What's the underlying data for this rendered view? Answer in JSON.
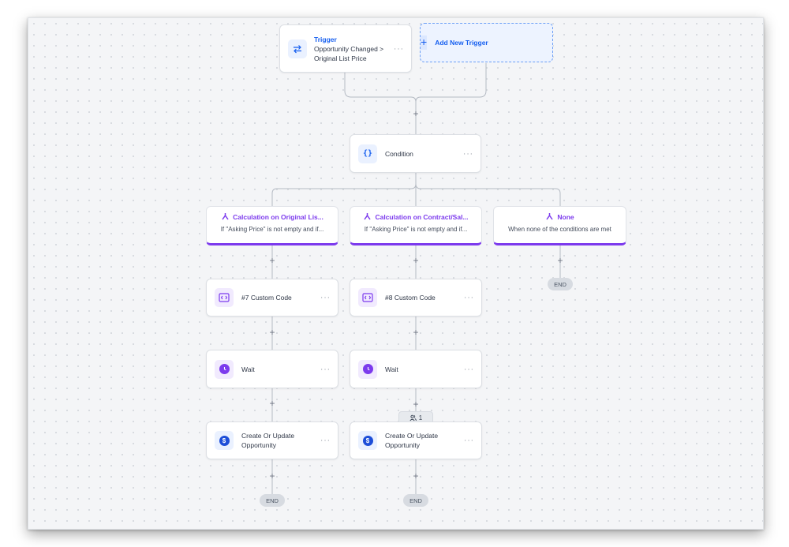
{
  "trigger": {
    "title": "Trigger",
    "subtitle_line1": "Opportunity Changed >",
    "subtitle_line2": "Original List Price",
    "menu": "···"
  },
  "add_trigger": {
    "label": "Add New Trigger",
    "plus": "+"
  },
  "condition": {
    "label": "Condition",
    "icon_text": "{}",
    "menu": "···"
  },
  "branches": [
    {
      "title": "Calculation on Original Lis...",
      "subtitle": "If \"Asking Price\" is not empty and if..."
    },
    {
      "title": "Calculation on Contract/Sal...",
      "subtitle": "If \"Asking Price\" is not empty and if..."
    },
    {
      "title": "None",
      "subtitle": "When none of the conditions are met"
    }
  ],
  "left": {
    "code": {
      "label": "#7 Custom Code",
      "menu": "···"
    },
    "wait": {
      "label": "Wait",
      "menu": "···"
    },
    "opp": {
      "line1": "Create Or Update",
      "line2": "Opportunity",
      "menu": "···",
      "icon_text": "$"
    },
    "end": "END"
  },
  "mid": {
    "code": {
      "label": "#8 Custom Code",
      "menu": "···"
    },
    "wait": {
      "label": "Wait",
      "menu": "···"
    },
    "count": "1",
    "opp": {
      "line1": "Create Or Update",
      "line2": "Opportunity",
      "menu": "···",
      "icon_text": "$"
    },
    "end": "END"
  },
  "right": {
    "end": "END"
  },
  "plus_symbol": "+",
  "colors": {
    "accent_blue": "#155eef",
    "accent_purple": "#7c3aed",
    "canvas": "#f4f5f7"
  }
}
